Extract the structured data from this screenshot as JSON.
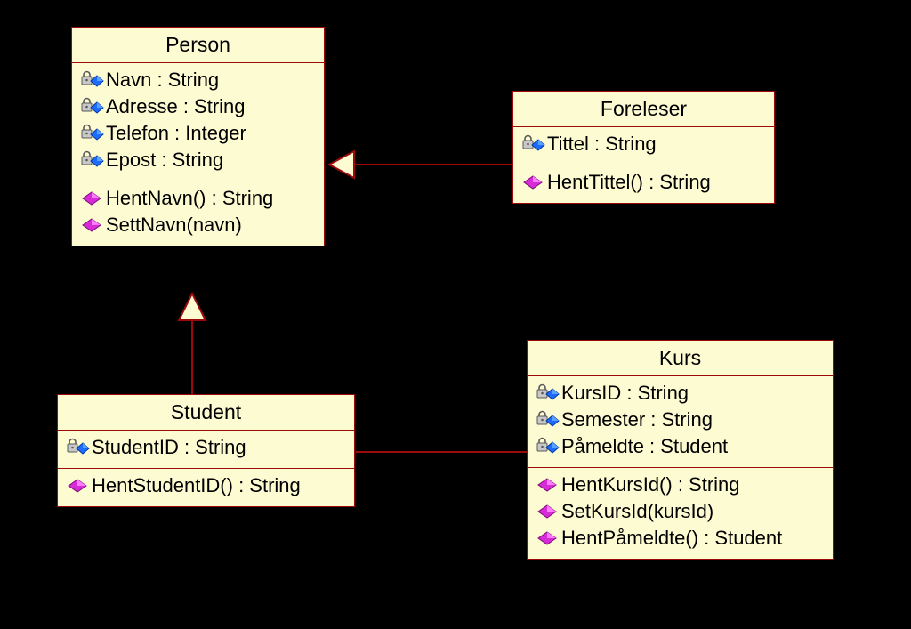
{
  "classes": {
    "person": {
      "name": "Person",
      "attributes": [
        {
          "label": "Navn : String"
        },
        {
          "label": "Adresse : String"
        },
        {
          "label": "Telefon : Integer"
        },
        {
          "label": "Epost : String"
        }
      ],
      "methods": [
        {
          "label": "HentNavn() : String"
        },
        {
          "label": "SettNavn(navn)"
        }
      ]
    },
    "foreleser": {
      "name": "Foreleser",
      "attributes": [
        {
          "label": "Tittel : String"
        }
      ],
      "methods": [
        {
          "label": "HentTittel() : String"
        }
      ]
    },
    "student": {
      "name": "Student",
      "attributes": [
        {
          "label": "StudentID : String"
        }
      ],
      "methods": [
        {
          "label": "HentStudentID() : String"
        }
      ]
    },
    "kurs": {
      "name": "Kurs",
      "attributes": [
        {
          "label": "KursID : String"
        },
        {
          "label": "Semester : String"
        },
        {
          "label": "Påmeldte : Student"
        }
      ],
      "methods": [
        {
          "label": "HentKursId() : String"
        },
        {
          "label": "SetKursId(kursId)"
        },
        {
          "label": "HentPåmeldte() : Student"
        }
      ]
    }
  },
  "relations": [
    {
      "from": "foreleser",
      "to": "person",
      "type": "generalization"
    },
    {
      "from": "student",
      "to": "person",
      "type": "generalization"
    },
    {
      "from": "student",
      "to": "kurs",
      "type": "association"
    }
  ]
}
